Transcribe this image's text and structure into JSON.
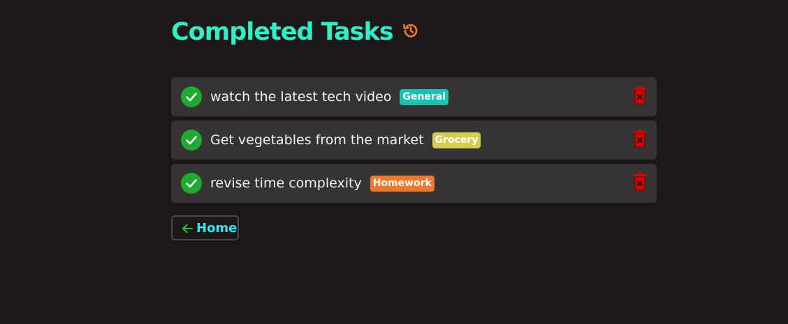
{
  "page": {
    "title": "Completed Tasks",
    "title_icon": "history-icon"
  },
  "tasks": [
    {
      "text": "watch the latest tech video",
      "category": "General",
      "category_color": "#17c3b5",
      "status_icon": "check-circle-icon",
      "delete_icon": "trash-icon"
    },
    {
      "text": "Get vegetables from the market",
      "category": "Grocery",
      "category_color": "#d4cf4a",
      "status_icon": "check-circle-icon",
      "delete_icon": "trash-icon"
    },
    {
      "text": "revise time complexity",
      "category": "Homework",
      "category_color": "#f2772a",
      "status_icon": "check-circle-icon",
      "delete_icon": "trash-icon"
    }
  ],
  "nav": {
    "home_label": "Home",
    "home_icon": "arrow-left-icon"
  },
  "colors": {
    "background": "#1c1718",
    "title": "#2ef0c8",
    "history_icon": "#f47b28",
    "task_background": "#353334",
    "check": "#1fab2f",
    "trash": "#e00000",
    "home_text": "#2ee8f0",
    "home_arrow": "#2fc02f"
  }
}
